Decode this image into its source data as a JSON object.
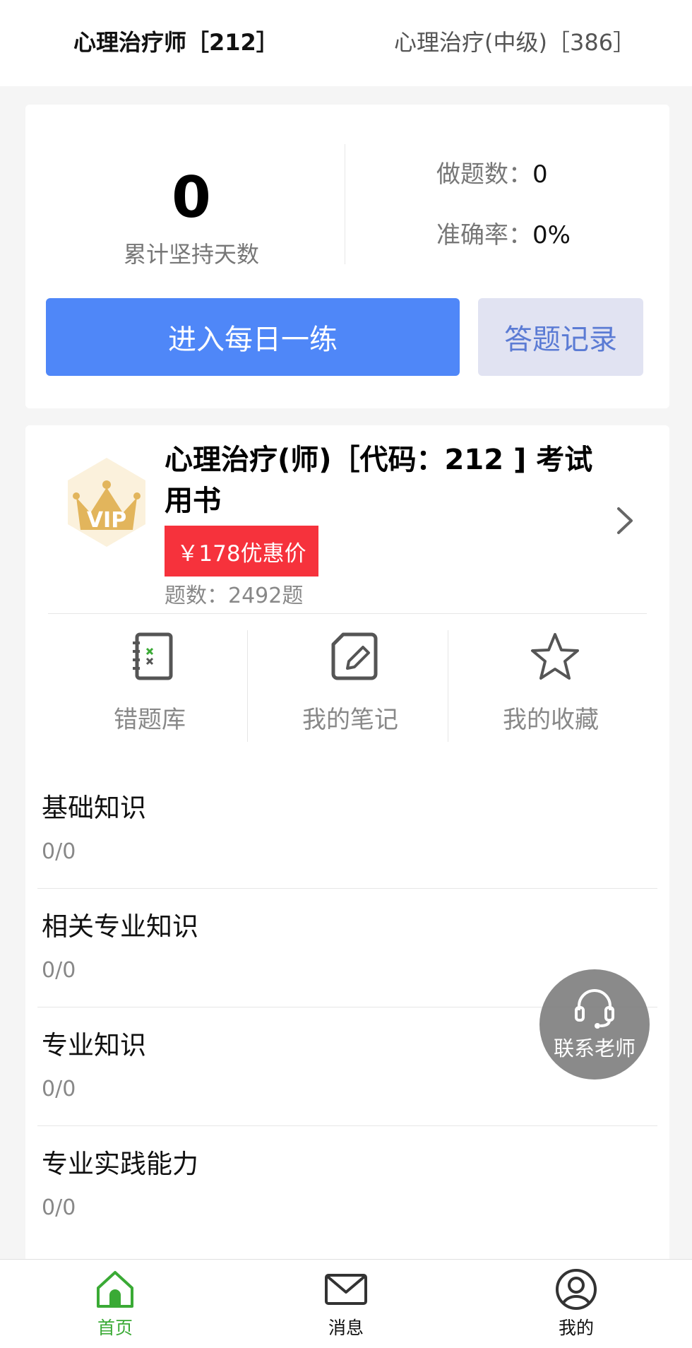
{
  "top_tabs": {
    "active": "心理治疗师［212］",
    "inactive": "心理治疗(中级)［386］"
  },
  "stats": {
    "days_value": "0",
    "days_label": "累计坚持天数",
    "questions_label": "做题数：",
    "questions_value": "0",
    "accuracy_label": "准确率：",
    "accuracy_value": "0%",
    "daily_button": "进入每日一练",
    "record_button": "答题记录"
  },
  "book": {
    "badge_text": "VIP",
    "title": "心理治疗(师)［代码：212 ] 考试用书",
    "price": "￥178优惠价",
    "question_count": "题数：2492题"
  },
  "tools": {
    "wrong": "错题库",
    "notes": "我的笔记",
    "favorites": "我的收藏"
  },
  "chapters": [
    {
      "name": "基础知识",
      "progress": "0/0"
    },
    {
      "name": "相关专业知识",
      "progress": "0/0"
    },
    {
      "name": "专业知识",
      "progress": "0/0"
    },
    {
      "name": "专业实践能力",
      "progress": "0/0"
    }
  ],
  "contact": {
    "label": "联系老师",
    "icon": "headset-icon"
  },
  "nav": {
    "home": "首页",
    "messages": "消息",
    "mine": "我的"
  },
  "colors": {
    "primary_blue": "#4f87f8",
    "price_red": "#f6323c",
    "nav_active_green": "#3aaa35",
    "record_bg": "#e1e3f2",
    "vip_gold": "#e0b45a"
  }
}
